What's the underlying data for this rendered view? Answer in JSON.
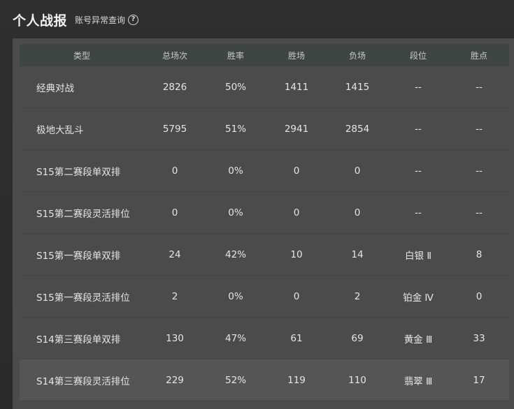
{
  "header": {
    "title": "个人战报",
    "link_label": "账号异常查询",
    "help_glyph": "?"
  },
  "table": {
    "columns": [
      "类型",
      "总场次",
      "胜率",
      "胜场",
      "负场",
      "段位",
      "胜点"
    ],
    "rows": [
      {
        "type": "经典对战",
        "total": "2826",
        "rate": "50%",
        "wins": "1411",
        "losses": "1415",
        "tier": "--",
        "points": "--"
      },
      {
        "type": "极地大乱斗",
        "total": "5795",
        "rate": "51%",
        "wins": "2941",
        "losses": "2854",
        "tier": "--",
        "points": "--"
      },
      {
        "type": "S15第二赛段单双排",
        "total": "0",
        "rate": "0%",
        "wins": "0",
        "losses": "0",
        "tier": "--",
        "points": "--"
      },
      {
        "type": "S15第二赛段灵活排位",
        "total": "0",
        "rate": "0%",
        "wins": "0",
        "losses": "0",
        "tier": "--",
        "points": "--"
      },
      {
        "type": "S15第一赛段单双排",
        "total": "24",
        "rate": "42%",
        "wins": "10",
        "losses": "14",
        "tier": "白银 Ⅱ",
        "points": "8"
      },
      {
        "type": "S15第一赛段灵活排位",
        "total": "2",
        "rate": "0%",
        "wins": "0",
        "losses": "2",
        "tier": "铂金 Ⅳ",
        "points": "0"
      },
      {
        "type": "S14第三赛段单双排",
        "total": "130",
        "rate": "47%",
        "wins": "61",
        "losses": "69",
        "tier": "黄金 Ⅲ",
        "points": "33"
      },
      {
        "type": "S14第三赛段灵活排位",
        "total": "229",
        "rate": "52%",
        "wins": "119",
        "losses": "110",
        "tier": "翡翠 Ⅲ",
        "points": "17"
      }
    ],
    "highlighted_row": 7
  },
  "colors": {
    "background": "#2c2c2c",
    "panel": "#4b4b4b",
    "header_row": "#3f4542",
    "highlight_row": "#555555",
    "text": "#e6e6e6"
  },
  "icons": {
    "help": "question-circle-icon"
  }
}
